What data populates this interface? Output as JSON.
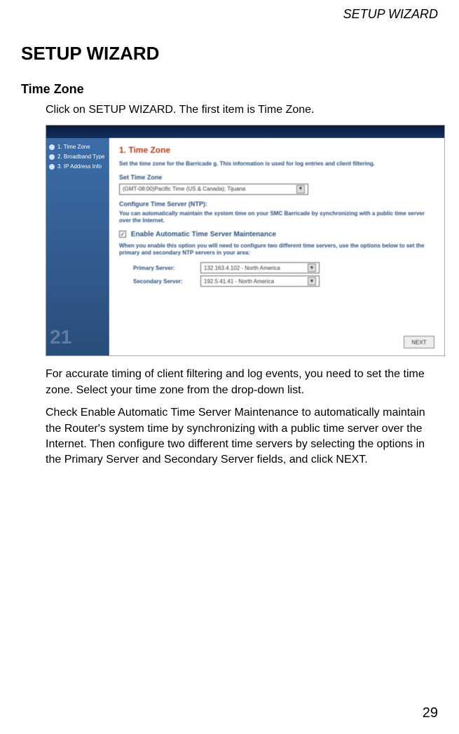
{
  "header_label": "SETUP WIZARD",
  "page_title": "SETUP WIZARD",
  "section_title": "Time Zone",
  "intro_text": "Click on SETUP WIZARD. The first item is Time Zone.",
  "para1": "For accurate timing of client filtering and log events, you need to set the time zone. Select your time zone from the drop-down list.",
  "para2": "Check Enable Automatic Time Server Maintenance to automatically maintain the Router's system time by synchronizing with a public time server over the Internet. Then configure two different time servers by selecting the options in the Primary Server and Secondary Server fields, and click NEXT.",
  "page_number": "29",
  "screenshot": {
    "sidebar": {
      "items": [
        "1. Time Zone",
        "2. Broadband Type",
        "3. IP Address Info"
      ]
    },
    "main": {
      "heading": "1. Time Zone",
      "desc": "Set the time zone for the Barricade g. This information is used for log entries and client filtering.",
      "set_tz_label": "Set Time Zone",
      "tz_value": "(GMT-08:00)Pacific Time (US & Canada); Tijuana",
      "ntp_label": "Configure Time Server (NTP):",
      "ntp_desc": "You can automatically maintain the system time on your SMC Barricade by synchronizing with a public time server over the Internet.",
      "checkbox_label": "Enable Automatic Time Server Maintenance",
      "checkbox_desc": "When you enable this option you will need to configure two different time servers, use the options below to set the primary and secondary NTP servers in your area:",
      "primary_label": "Primary Server:",
      "primary_value": "132.163.4.102 - North America",
      "secondary_label": "Secondary Server:",
      "secondary_value": "192.5.41.41 - North America",
      "next_button": "NEXT"
    }
  }
}
